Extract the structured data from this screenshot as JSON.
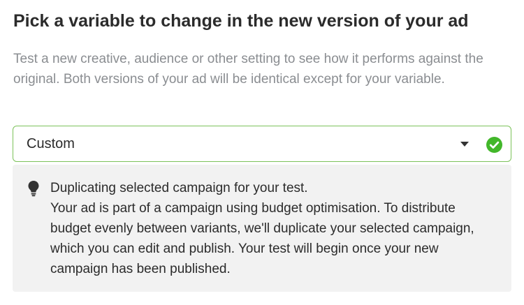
{
  "heading": "Pick a variable to change in the new version of your ad",
  "description": "Test a new creative, audience or other setting to see how it performs against the original. Both versions of your ad will be identical except for your variable.",
  "variable_select": {
    "value": "Custom",
    "caret_icon": "caret-down-icon",
    "status_icon": "check-circle-icon",
    "border_color": "#7cc25a",
    "status_color": "#42b72a"
  },
  "info": {
    "icon": "lightbulb-icon",
    "title": "Duplicating selected campaign for your test.",
    "body": "Your ad is part of a campaign using budget optimisation. To distribute budget evenly between variants, we'll duplicate your selected campaign, which you can edit and publish. Your test will begin once your new campaign has been published."
  }
}
